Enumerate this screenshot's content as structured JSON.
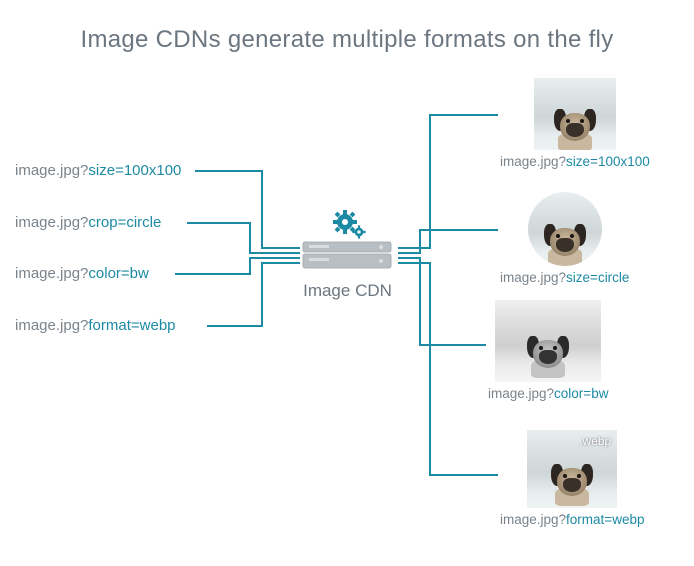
{
  "title": "Image CDNs generate multiple formats on the fly",
  "server_label": "Image CDN",
  "inputs": [
    {
      "base": "image.jpg?",
      "param": "size=100x100"
    },
    {
      "base": "image.jpg?",
      "param": "crop=circle"
    },
    {
      "base": "image.jpg?",
      "param": "color=bw"
    },
    {
      "base": "image.jpg?",
      "param": "format=webp"
    }
  ],
  "outputs": [
    {
      "base": "image.jpg?",
      "param": "size=100x100"
    },
    {
      "base": "image.jpg?",
      "param": "size=circle"
    },
    {
      "base": "image.jpg?",
      "param": "color=bw"
    },
    {
      "base": "image.jpg?",
      "param": "format=webp"
    }
  ],
  "webp_tag": ".webp"
}
